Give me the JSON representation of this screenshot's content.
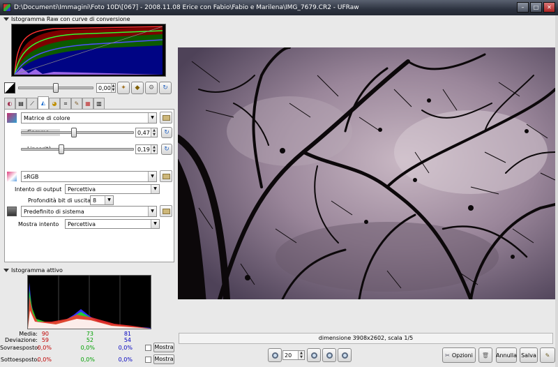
{
  "window": {
    "title": "D:\\Documenti\\Immagini\\Foto 10D\\[067] - 2008.11.08 Erice con Fabio\\Fabio e Marilena\\IMG_7679.CR2 - UFRaw",
    "minimize": "–",
    "maximize": "□",
    "close": "✕"
  },
  "raw_histogram": {
    "header": "Istogramma Raw con curve di conversione"
  },
  "exposure": {
    "value": "0,00",
    "fraction": 0.5
  },
  "color_tab": {
    "profile_input": {
      "label": "Matrice di colore"
    },
    "gamma": {
      "label": "Gamma",
      "value": "0,47",
      "fraction": 0.47
    },
    "linearity": {
      "label": "Linearità",
      "value": "0,19",
      "fraction": 0.35
    },
    "profile_output": {
      "label": "sRGB"
    },
    "output_intent": {
      "label": "Intento di output",
      "value": "Percettiva"
    },
    "bit_depth": {
      "label": "Profondità bit di uscita",
      "value": "8"
    },
    "profile_display": {
      "label": "Predefinito di sistema"
    },
    "display_intent": {
      "label": "Mostra intento",
      "value": "Percettiva"
    }
  },
  "active_histogram": {
    "header": "Istogramma attivo",
    "rows": [
      {
        "label": "Media:",
        "r": "90",
        "g": "73",
        "b": "81"
      },
      {
        "label": "Deviazione:",
        "r": "59",
        "g": "52",
        "b": "54"
      },
      {
        "label": "Sovraesposto:",
        "r": "0,0%",
        "g": "0,0%",
        "b": "0,0%",
        "button": "Mostra"
      },
      {
        "label": "Sottoesposto:",
        "r": "0,0%",
        "g": "0,0%",
        "b": "0,0%",
        "button": "Mostra"
      }
    ]
  },
  "status": {
    "text": "dimensione 3908x2602, scala 1/5"
  },
  "bottombar": {
    "zoom": "20",
    "options": "Opzioni",
    "cancel": "Annulla",
    "save": "Salva"
  },
  "colors": {
    "red": "#c00000",
    "green": "#00a000",
    "blue": "#0000c0",
    "sky": "#7a6c7c"
  }
}
